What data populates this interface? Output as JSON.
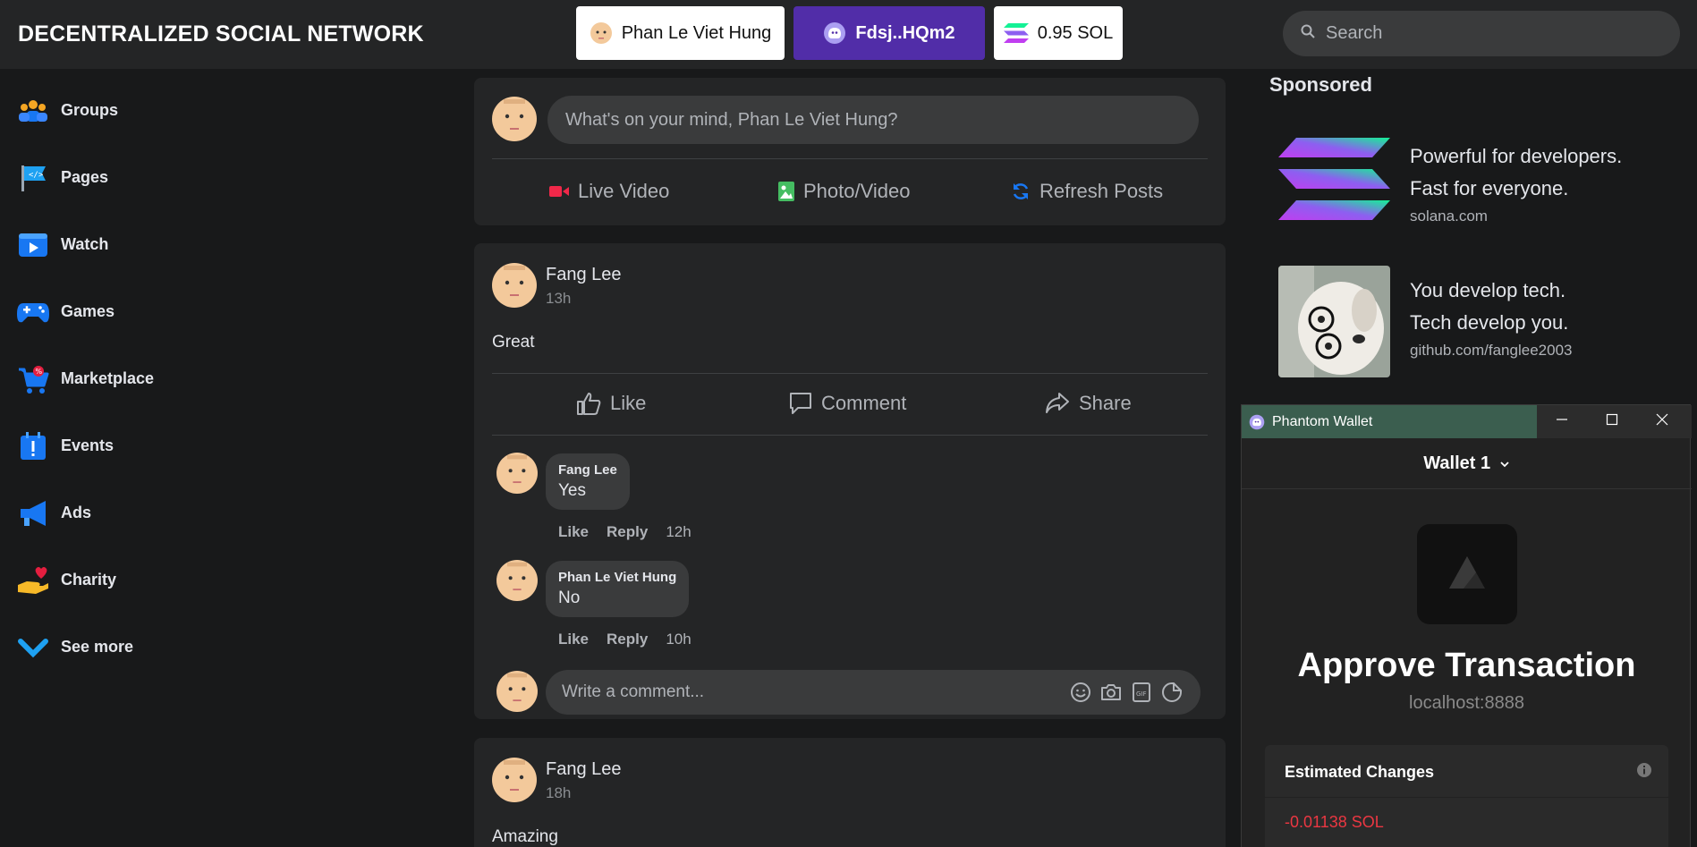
{
  "header": {
    "brand": "DECENTRALIZED SOCIAL NETWORK",
    "user_button": "Phan Le Viet Hung",
    "wallet_button": "Fdsj..HQm2",
    "balance_button": "0.95 SOL",
    "search_placeholder": "Search"
  },
  "sidebar": {
    "items": [
      {
        "label": "Groups",
        "icon": "groups-icon"
      },
      {
        "label": "Pages",
        "icon": "pages-flag-icon"
      },
      {
        "label": "Watch",
        "icon": "watch-play-icon"
      },
      {
        "label": "Games",
        "icon": "gamepad-icon"
      },
      {
        "label": "Marketplace",
        "icon": "cart-icon"
      },
      {
        "label": "Events",
        "icon": "calendar-icon"
      },
      {
        "label": "Ads",
        "icon": "megaphone-icon"
      },
      {
        "label": "Charity",
        "icon": "heart-hand-icon"
      },
      {
        "label": "See more",
        "icon": "chevron-down-icon"
      }
    ]
  },
  "composer": {
    "placeholder": "What's on your mind, Phan Le Viet Hung?",
    "actions": [
      "Live Video",
      "Photo/Video",
      "Refresh Posts"
    ]
  },
  "posts": [
    {
      "author": "Fang Lee",
      "time": "13h",
      "text": "Great",
      "actions": [
        "Like",
        "Comment",
        "Share"
      ],
      "comments": [
        {
          "author": "Fang Lee",
          "text": "Yes",
          "like": "Like",
          "reply": "Reply",
          "time": "12h"
        },
        {
          "author": "Phan Le Viet Hung",
          "text": "No",
          "like": "Like",
          "reply": "Reply",
          "time": "10h"
        }
      ],
      "write_placeholder": "Write a comment..."
    },
    {
      "author": "Fang Lee",
      "time": "18h",
      "text": "Amazing"
    }
  ],
  "sponsored": {
    "title": "Sponsored",
    "ads": [
      {
        "line1": "Powerful for developers.",
        "line2": "Fast for everyone.",
        "url": "solana.com"
      },
      {
        "line1": "You develop tech.",
        "line2": "Tech develop you.",
        "url": "github.com/fanglee2003"
      }
    ]
  },
  "phantom": {
    "title": "Phantom Wallet",
    "wallet_name": "Wallet 1",
    "heading": "Approve Transaction",
    "origin": "localhost:8888",
    "estimated_label": "Estimated Changes",
    "estimated_value": "-0.01138 SOL"
  },
  "colors": {
    "background": "#18191a",
    "card": "#242526",
    "accent_purple": "#512da8",
    "phantom_titlebar": "#3b5e4f",
    "negative": "#eb3742"
  }
}
